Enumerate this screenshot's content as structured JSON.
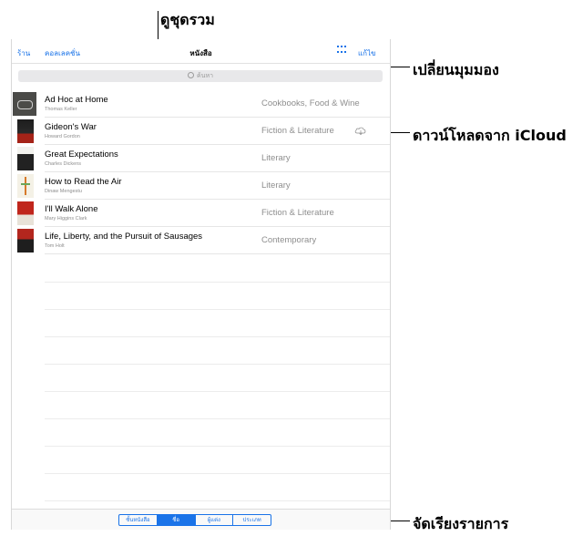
{
  "callouts": {
    "view_collections": "ดูชุดรวม",
    "change_view": "เปลี่ยนมุมมอง",
    "download_icloud": "ดาวน์โหลดจาก iCloud",
    "sort_items": "จัดเรียงรายการ"
  },
  "nav": {
    "store": "ร้าน",
    "collections": "คอลเลคชั่น",
    "title": "หนังสือ",
    "edit": "แก้ไข"
  },
  "search": {
    "placeholder": "ค้นหา"
  },
  "books": [
    {
      "title": "Ad Hoc at Home",
      "author": "Thomas Keller",
      "genre": "Cookbooks, Food & Wine"
    },
    {
      "title": "Gideon's War",
      "author": "Howard Gordon",
      "genre": "Fiction & Literature"
    },
    {
      "title": "Great Expectations",
      "author": "Charles Dickens",
      "genre": "Literary"
    },
    {
      "title": "How to Read the Air",
      "author": "Dinaw Mengestu",
      "genre": "Literary"
    },
    {
      "title": "I'll Walk Alone",
      "author": "Mary Higgins Clark",
      "genre": "Fiction & Literature"
    },
    {
      "title": "Life, Liberty, and the Pursuit of Sausages",
      "author": "Tom Holt",
      "genre": "Contemporary"
    }
  ],
  "sort": {
    "options": [
      "ชั้นหนังสือ",
      "ชื่อ",
      "ผู้แต่ง",
      "ประเภท"
    ],
    "selected": "ชื่อ"
  },
  "colors": {
    "accent": "#1a73e8"
  }
}
